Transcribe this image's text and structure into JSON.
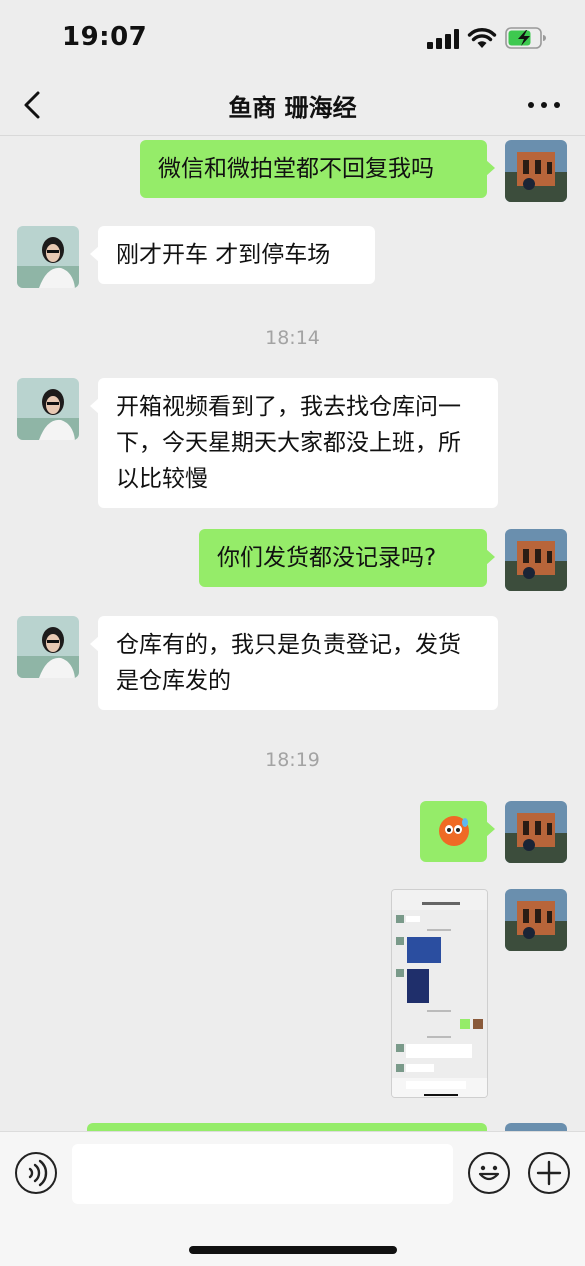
{
  "status_bar": {
    "time": "19:07"
  },
  "nav": {
    "title": "鱼商 珊海经"
  },
  "messages": [
    {
      "side": "right",
      "type": "text",
      "text": "微信和微拍堂都不回复我吗"
    },
    {
      "side": "left",
      "type": "text",
      "text": "刚才开车 才到停车场"
    },
    {
      "type": "time",
      "text": "18:14"
    },
    {
      "side": "left",
      "type": "text",
      "text": "开箱视频看到了，我去找仓库问一下，今天星期天大家都没上班，所以比较慢"
    },
    {
      "side": "right",
      "type": "text",
      "text": "你们发货都没记录吗?"
    },
    {
      "side": "left",
      "type": "text",
      "text": "仓库有的，我只是负责登记，发货是仓库发的"
    },
    {
      "type": "time",
      "text": "18:19"
    },
    {
      "side": "right",
      "type": "emoji",
      "emoji": "anxious-sweat-face-icon"
    },
    {
      "side": "right",
      "type": "image",
      "image": "chat-screenshot-thumbnail"
    }
  ],
  "input": {
    "placeholder": ""
  },
  "colors": {
    "bubble_sent": "#95ec69",
    "bubble_received": "#ffffff",
    "background": "#ededed"
  }
}
